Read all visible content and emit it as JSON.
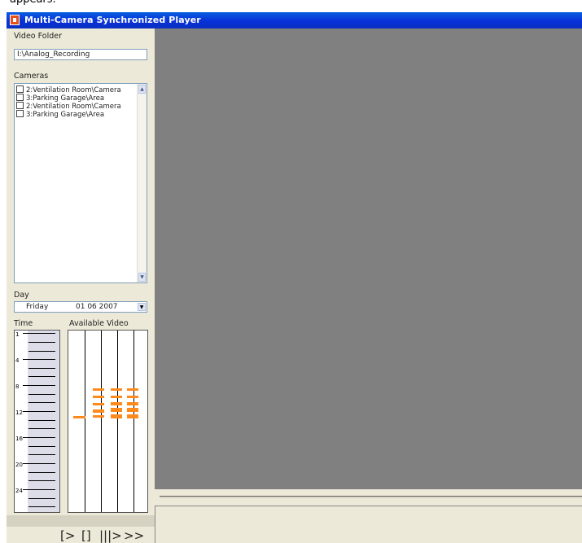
{
  "window": {
    "title": "Multi-Camera Synchronized Player"
  },
  "left": {
    "video_folder": {
      "label": "Video Folder",
      "value": "I:\\Analog_Recording"
    },
    "cameras": {
      "label": "Cameras",
      "items": [
        {
          "label": "2:Ventilation Room\\Camera"
        },
        {
          "label": "3:Parking Garage\\Area"
        },
        {
          "label": "2:Ventilation Room\\Camera"
        },
        {
          "label": "3:Parking Garage\\Area"
        }
      ]
    },
    "day": {
      "label": "Day",
      "weekday": "Friday",
      "date": "01 06 2007"
    },
    "time": {
      "label": "Time",
      "hour_marks": [
        "1",
        "4",
        "8",
        "12",
        "16",
        "20",
        "24"
      ]
    },
    "available_video": {
      "label": "Available Video"
    }
  },
  "controls": {
    "play": "[>",
    "stop": "[]",
    "step": "|||>",
    "fast_forward": ">>"
  },
  "colors": {
    "segment": "#ff8a1c",
    "video_bg": "#808080"
  }
}
